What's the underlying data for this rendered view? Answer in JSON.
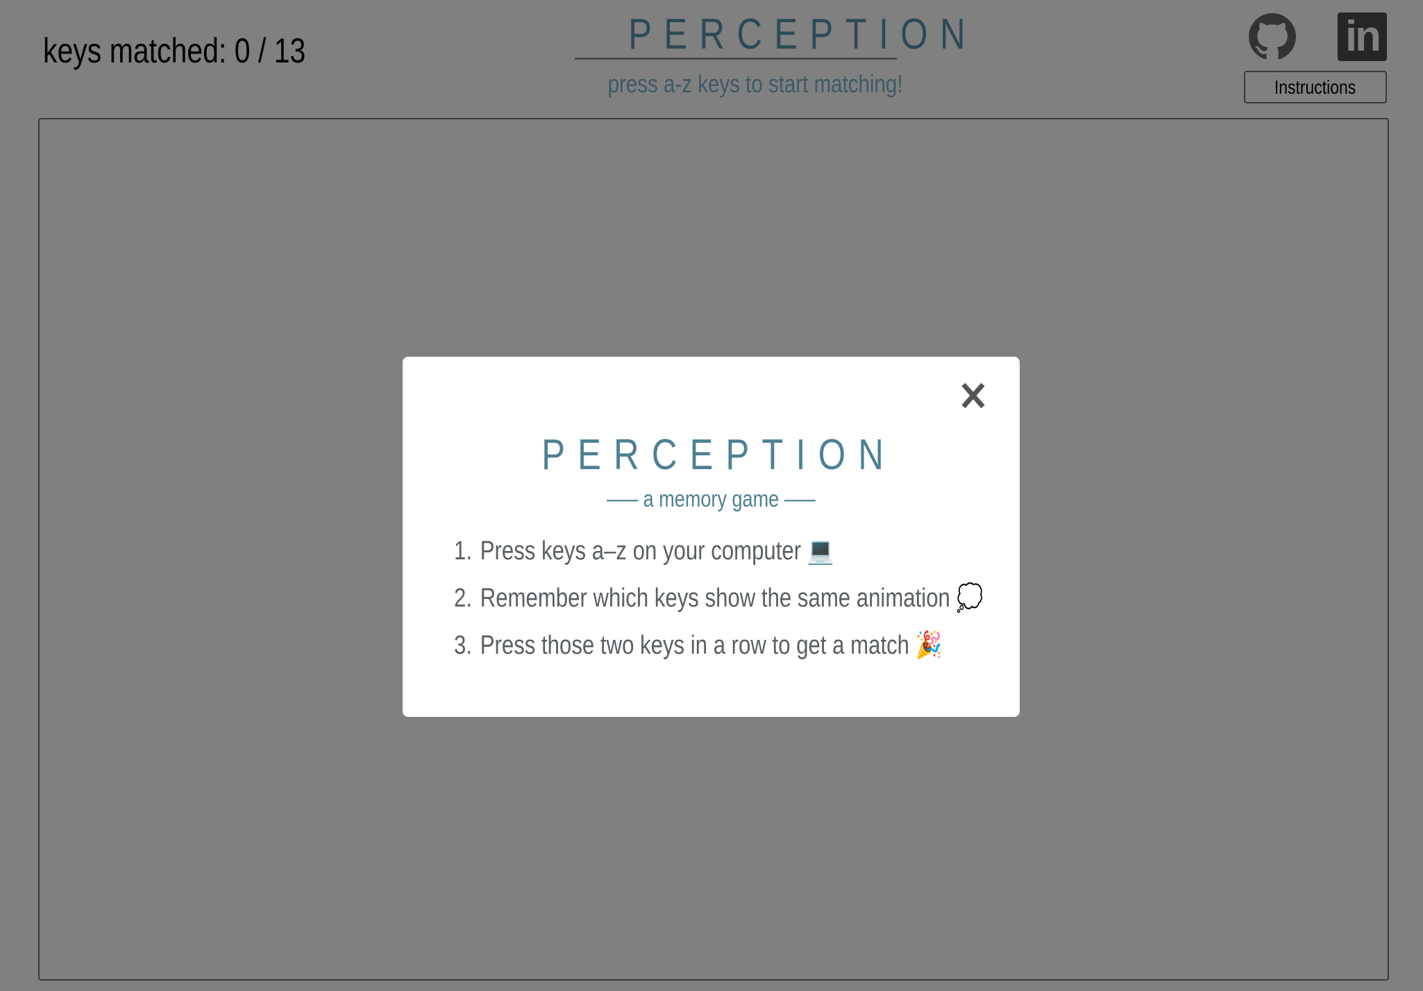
{
  "header": {
    "score_label": "keys matched:",
    "score_value": "0 / 13",
    "title": "PERCEPTION",
    "subtitle": "press a-z keys to start matching!",
    "instructions_button": "Instructions",
    "icons": [
      "github-icon",
      "linkedin-icon"
    ],
    "linkedin_glyph": "in"
  },
  "modal": {
    "title": "PERCEPTION",
    "subtitle": "––– a memory game –––",
    "close_glyph": "×",
    "steps": [
      {
        "num": "1.",
        "text": "Press keys a–z on your computer",
        "emoji": "💻"
      },
      {
        "num": "2.",
        "text": "Remember which keys show the same animation",
        "emoji": "💭"
      },
      {
        "num": "3.",
        "text": "Press those two keys in a row to get a match",
        "emoji": "🎉"
      }
    ]
  },
  "colors": {
    "overlay": "#808080",
    "modal_title": "#4e8094",
    "header_title": "#2c4a55",
    "modal_text": "#5a5f63"
  }
}
